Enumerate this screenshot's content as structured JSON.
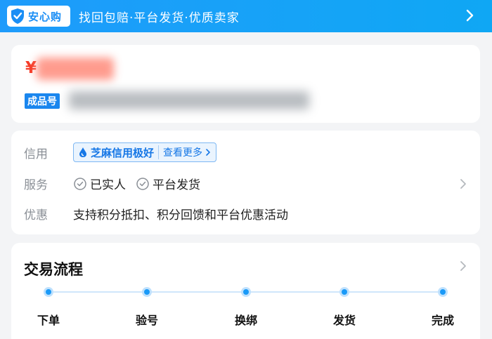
{
  "banner": {
    "badge_text": "安心购",
    "slogan": "找回包赔·平台发货·优质卖家"
  },
  "product": {
    "currency_symbol": "¥",
    "tag_label": "成品号"
  },
  "details": {
    "credit_label": "信用",
    "credit_badge": "芝麻信用极好",
    "credit_more": "查看更多",
    "service_label": "服务",
    "services": [
      "已实人",
      "平台发货"
    ],
    "discount_label": "优惠",
    "discount_text": "支持积分抵扣、积分回馈和平台优惠活动"
  },
  "flow": {
    "title": "交易流程",
    "steps": [
      "下单",
      "验号",
      "换绑",
      "发货",
      "完成"
    ]
  },
  "colors": {
    "accent_blue": "#1a86ee",
    "price_red": "#f53c28"
  }
}
